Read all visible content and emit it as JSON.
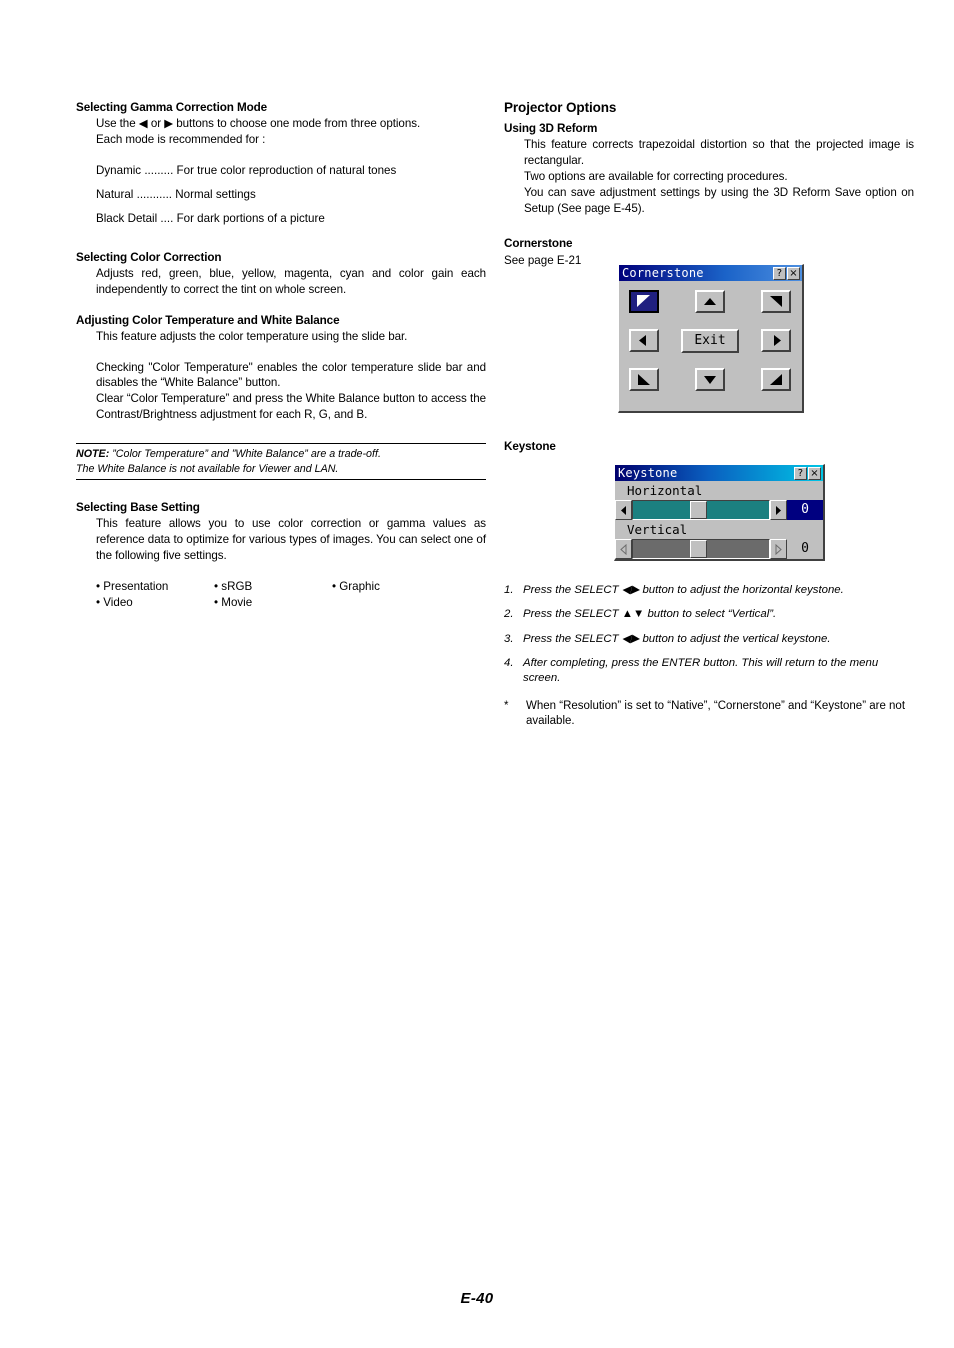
{
  "page": {
    "footer": "E-40"
  },
  "left_column": {
    "gamma": {
      "heading": "Selecting Gamma Correction Mode",
      "intro_line1": "Use the ◀ or ▶ buttons to choose one mode from three options.",
      "intro_line2": "Each mode is recommended for :",
      "modes": [
        {
          "name": "Dynamic .........",
          "desc": "For true color reproduction of natural tones"
        },
        {
          "name": "Natural ...........",
          "desc": "Normal settings"
        },
        {
          "name": "Black Detail ....",
          "desc": "For dark portions of a picture"
        }
      ]
    },
    "color_correction": {
      "heading": "Selecting Color Correction",
      "body": "Adjusts red, green, blue, yellow, magenta, cyan and color gain each independently to correct the tint on whole screen."
    },
    "color_temp": {
      "heading": "Adjusting Color Temperature and White Balance",
      "body1": "This feature adjusts the color temperature using the slide bar.",
      "body2": "Checking \"Color Temperature\" enables the color temperature slide bar and disables the “White Balance” button.",
      "body3": "Clear “Color Temperature” and press the White Balance button to access the Contrast/Brightness adjustment for each R, G, and B."
    },
    "note": {
      "label": "NOTE:",
      "line1": " ”Color Temperature” and ”White Balance” are a trade-off.",
      "line2": "The White Balance is not available for Viewer and LAN."
    },
    "base_setting": {
      "heading": "Selecting Base Setting",
      "body": "This feature allows you to use color correction or gamma values as reference data to optimize for various types of images. You can select one of the following five settings.",
      "options_row1": [
        "• Presentation",
        "• sRGB",
        "• Graphic"
      ],
      "options_row2": [
        "• Video",
        "• Movie",
        ""
      ]
    }
  },
  "right_column": {
    "title": "Projector Options",
    "reform": {
      "heading": "Using 3D Reform",
      "body1": "This feature corrects trapezoidal distortion so that the projected image is rectangular.",
      "body2": "Two options are available for correcting procedures.",
      "body3": "You can save adjustment settings by using the 3D Reform Save option on Setup (See page E-45)."
    },
    "cornerstone": {
      "heading": "Cornerstone",
      "see_page": "See page E-21"
    },
    "keystone_heading": "Keystone",
    "steps": [
      {
        "num": "1.",
        "text": "Press the SELECT ◀▶ button to adjust the horizontal keystone."
      },
      {
        "num": "2.",
        "text": "Press the SELECT ▲▼ button to select “Vertical”."
      },
      {
        "num": "3.",
        "text": "Press the SELECT ◀▶ button to adjust the vertical keystone."
      },
      {
        "num": "4.",
        "text": "After completing, press the ENTER button. This will return to the menu screen."
      }
    ],
    "footnote": {
      "marker": "*",
      "text": "When “Resolution” is set to “Native”, “Cornerstone” and “Keystone” are not available."
    }
  },
  "cornerstone_dialog": {
    "title": "Cornerstone",
    "help_label": "?",
    "close_label": "×",
    "exit_label": "Exit",
    "buttons": [
      "corner-top-left",
      "arrow-up",
      "corner-top-right",
      "arrow-left",
      "exit",
      "arrow-right",
      "corner-bottom-left",
      "arrow-down",
      "corner-bottom-right"
    ],
    "selected_button": "corner-top-left",
    "selected_bg": "#202080",
    "face_color": "#c0c0c0"
  },
  "keystone_dialog": {
    "title": "Keystone",
    "help_label": "?",
    "close_label": "×",
    "rows": [
      {
        "label": "Horizontal",
        "value": "0",
        "active": true,
        "thumb_pct": 42,
        "track_color": "#1b8080",
        "value_bg": "#000080"
      },
      {
        "label": "Vertical",
        "value": "0",
        "active": false,
        "thumb_pct": 42,
        "track_color": "#6b6b6b",
        "value_bg": "#c0c0c0"
      }
    ]
  }
}
